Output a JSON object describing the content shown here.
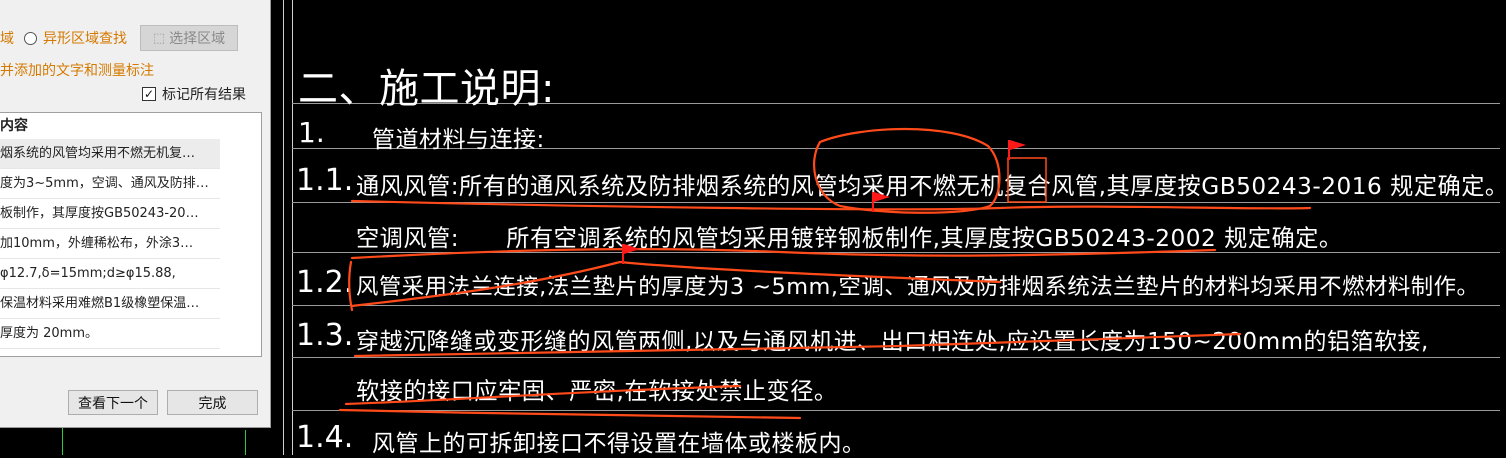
{
  "colors": {
    "background": "#000000",
    "text": "#ffffff",
    "markup": "#ff4a1a",
    "flag": "#ff1a1a",
    "dialog_bg": "#f0f0f0",
    "option_orange": "#d57a00"
  },
  "dialog": {
    "search_type_partial": "域",
    "irregular_label": "异形区域查找",
    "select_area_label": "选择区域",
    "select_area_icon": "dashed-select-icon",
    "ignore_note": "并添加的文字和测量标注",
    "mark_all_label": "标记所有结果",
    "mark_all_checked": true,
    "results_header": "内容",
    "results": [
      "烟系统的风管均采用不燃无机复…",
      "度为3~5mm，空调、通风及防排…",
      "板制作，其厚度按GB50243-20…",
      "加10mm，外缠稀松布，外涂3…",
      "φ12.7,δ=15mm;d≥φ15.88,",
      "保温材料采用难燃B1级橡塑保温…",
      "厚度为 20mm。"
    ],
    "find_next_label": "查看下一个",
    "done_label": "完成"
  },
  "drawing": {
    "heading": "二、施工说明:",
    "section1_num": "1.",
    "section1_title": "管道材料与连接:",
    "item_1_1_num": "1.1.",
    "item_1_1_text": "通风风管:所有的通风系统及防排烟系统的风管均采用不燃无机复合风管,其厚度按GB50243-2016 规定确定。",
    "item_1_1b_text": "空调风管:      所有空调系统的风管均采用镀锌钢板制作,其厚度按GB50243-2002 规定确定。",
    "item_1_2_num": "1.2.",
    "item_1_2_text": "风管采用法兰连接,法兰垫片的厚度为3 ~5mm,空调、通风及防排烟系统法兰垫片的材料均采用不燃材料制作。",
    "item_1_3_num": "1.3.",
    "item_1_3_text": "穿越沉降缝或变形缝的风管两侧,以及与通风机进、出口相连处,应设置长度为150~200mm的铝箔软接,",
    "item_1_3b_text": "软接的接口应牢固、严密,在软接处禁止变径。",
    "item_1_4_num": "1.4.",
    "item_1_4_text": "风管上的可拆卸接口不得设置在墙体或楼板内。"
  }
}
